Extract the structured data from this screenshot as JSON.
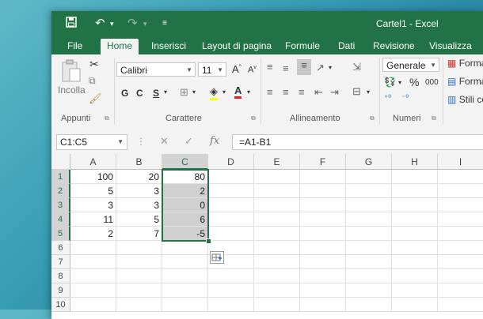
{
  "window": {
    "title": "Cartel1 - Excel"
  },
  "quick_access": {
    "save_icon": "save-icon",
    "undo_icon": "undo-icon",
    "redo_icon": "redo-icon",
    "customize_icon": "customize-icon"
  },
  "tabs": [
    "File",
    "Home",
    "Inserisci",
    "Layout di pagina",
    "Formule",
    "Dati",
    "Revisione",
    "Visualizza"
  ],
  "ribbon": {
    "clipboard": {
      "paste_label": "Incolla",
      "group_label": "Appunti"
    },
    "font": {
      "name": "Calibri",
      "size": "11",
      "bold": "G",
      "italic": "C",
      "underline": "S",
      "group_label": "Carattere"
    },
    "alignment": {
      "group_label": "Allineamento"
    },
    "number": {
      "format": "Generale",
      "percent": "%",
      "thousands": "000",
      "group_label": "Numeri"
    },
    "styles": {
      "item1": "Forma",
      "item2": "Forma",
      "item3": "Stili ce"
    }
  },
  "formula_bar": {
    "name_box": "C1:C5",
    "fx": "fx",
    "formula": "=A1-B1"
  },
  "columns": [
    "A",
    "B",
    "C",
    "D",
    "E",
    "F",
    "G",
    "H",
    "I"
  ],
  "rows": [
    "1",
    "2",
    "3",
    "4",
    "5",
    "6",
    "7",
    "8",
    "9",
    "10"
  ],
  "cells": [
    [
      "100",
      "20",
      "80"
    ],
    [
      "5",
      "3",
      "2"
    ],
    [
      "3",
      "3",
      "0"
    ],
    [
      "11",
      "5",
      "6"
    ],
    [
      "2",
      "7",
      "-5"
    ]
  ],
  "colors": {
    "accent": "#217346",
    "selection": "#d0d0d0"
  }
}
